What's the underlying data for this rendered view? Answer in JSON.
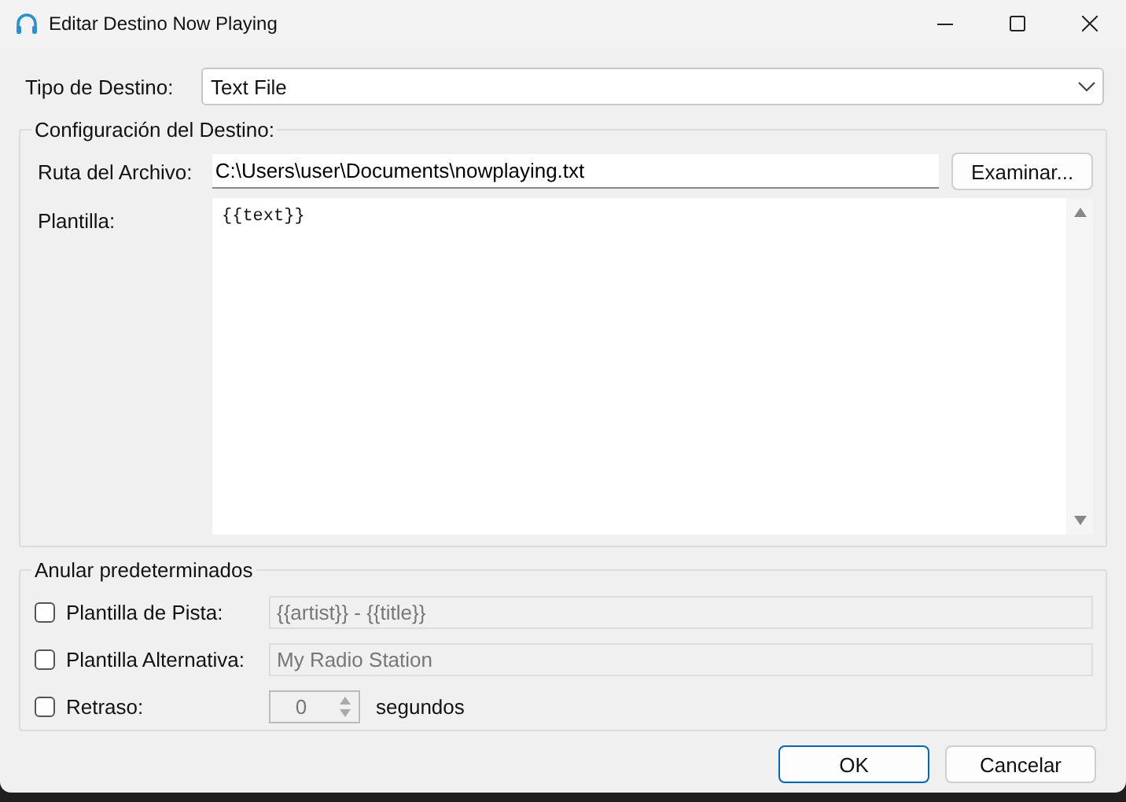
{
  "window": {
    "title": "Editar Destino Now Playing"
  },
  "destination_type": {
    "label": "Tipo de Destino:",
    "value": "Text File"
  },
  "destination_settings": {
    "title": "Configuración del Destino:",
    "file_path": {
      "label": "Ruta del Archivo:",
      "value": "C:\\Users\\user\\Documents\\nowplaying.txt"
    },
    "browse_button": "Examinar...",
    "template": {
      "label": "Plantilla:",
      "value": "{{text}}"
    }
  },
  "overrides": {
    "title": "Anular predeterminados",
    "rows": [
      {
        "kind": "text",
        "label": "Plantilla de Pista:",
        "checked": false,
        "value": "{{artist}} - {{title}}",
        "disabled": true
      },
      {
        "kind": "text",
        "label": "Plantilla Alternativa:",
        "checked": false,
        "value": "My Radio Station",
        "disabled": true
      },
      {
        "kind": "spinner",
        "label": "Retraso:",
        "checked": false,
        "value": "0",
        "disabled": true,
        "unit": "segundos"
      }
    ]
  },
  "buttons": [
    {
      "label": "OK",
      "default": true
    },
    {
      "label": "Cancelar",
      "default": false
    }
  ]
}
